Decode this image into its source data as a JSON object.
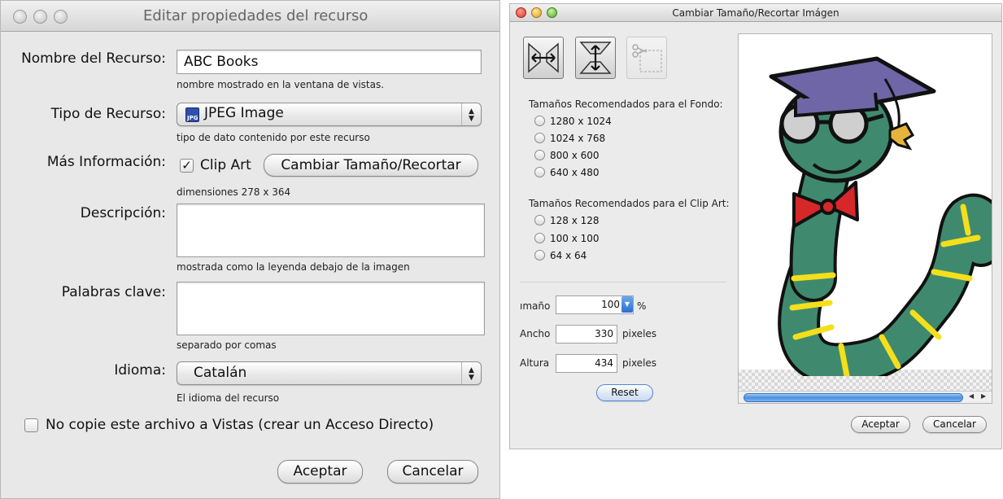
{
  "left_window": {
    "title": "Editar propiedades del recurso",
    "name_label": "Nombre del Recurso:",
    "name_value": "ABC Books",
    "name_hint": "nombre mostrado en la ventana de vistas.",
    "type_label": "Tipo de Recurso:",
    "type_value": "JPEG Image",
    "type_icon": "jpg-file-icon",
    "type_hint": "tipo de dato contenido por este recurso",
    "more_info_label": "Más Información:",
    "clipart_label": "Clip Art",
    "clipart_checked": true,
    "resize_button": "Cambiar Tamaño/Recortar",
    "dimensions_hint": "dimensiones 278 x 364",
    "description_label": "Descripción:",
    "description_value": "",
    "description_hint": "mostrada como la leyenda debajo de la imagen",
    "keywords_label": "Palabras clave:",
    "keywords_value": "",
    "keywords_hint": "separado por comas",
    "language_label": "Idioma:",
    "language_value": "Catalán",
    "language_hint": "El idioma del recurso",
    "no_copy_label": "No copie este archivo a Vistas (crear un Acceso Directo)",
    "no_copy_checked": false,
    "accept_button": "Aceptar",
    "cancel_button": "Cancelar"
  },
  "right_window": {
    "title": "Cambiar Tamaño/Recortar Imágen",
    "tools": [
      "stretch-horizontal-icon",
      "stretch-vertical-icon",
      "crop-icon"
    ],
    "background_sizes_label": "Tamaños Recomendados para el Fondo:",
    "background_sizes": [
      "1280 x 1024",
      "1024 x 768",
      "800 x 600",
      "640 x 480"
    ],
    "clipart_sizes_label": "Tamaños Recomendados para el Clip Art:",
    "clipart_sizes": [
      "128 x 128",
      "100 x 100",
      "64 x 64"
    ],
    "size_label": "ımaño",
    "size_value": "100",
    "size_unit": "%",
    "width_label": "Ancho",
    "width_value": "330",
    "height_label": "Altura",
    "height_value": "434",
    "pixels_unit": "pixeles",
    "reset_button": "Reset",
    "accept_button": "Aceptar",
    "cancel_button": "Cancelar",
    "preview_image": "bookworm-clipart"
  },
  "colors": {
    "worm_body": "#3f8a6e",
    "worm_stripes": "#f4df1c",
    "cap": "#6e66a6",
    "bow_tie": "#d62828",
    "scrollbar": "#4a8fe0"
  }
}
